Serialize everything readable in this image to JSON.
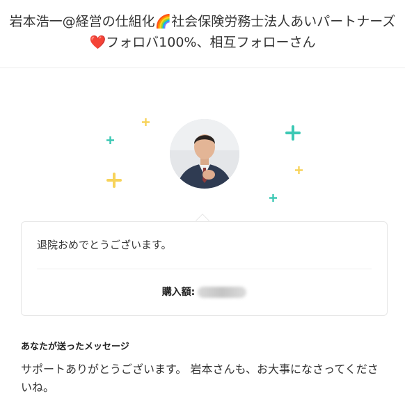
{
  "header": {
    "title": "岩本浩一@経営の仕組化🌈社会保険労務士法人あいパートナーズ❤️フォロバ100%、相互フォローさん"
  },
  "card": {
    "message": "退院おめでとうございます。",
    "amount_label": "購入額:"
  },
  "sent": {
    "heading": "あなたが送ったメッセージ",
    "body": "サポートありがとうございます。 岩本さんも、お大事になさってくださいね。"
  },
  "colors": {
    "teal": "#3cc8b4",
    "yellow": "#f7d35a"
  }
}
